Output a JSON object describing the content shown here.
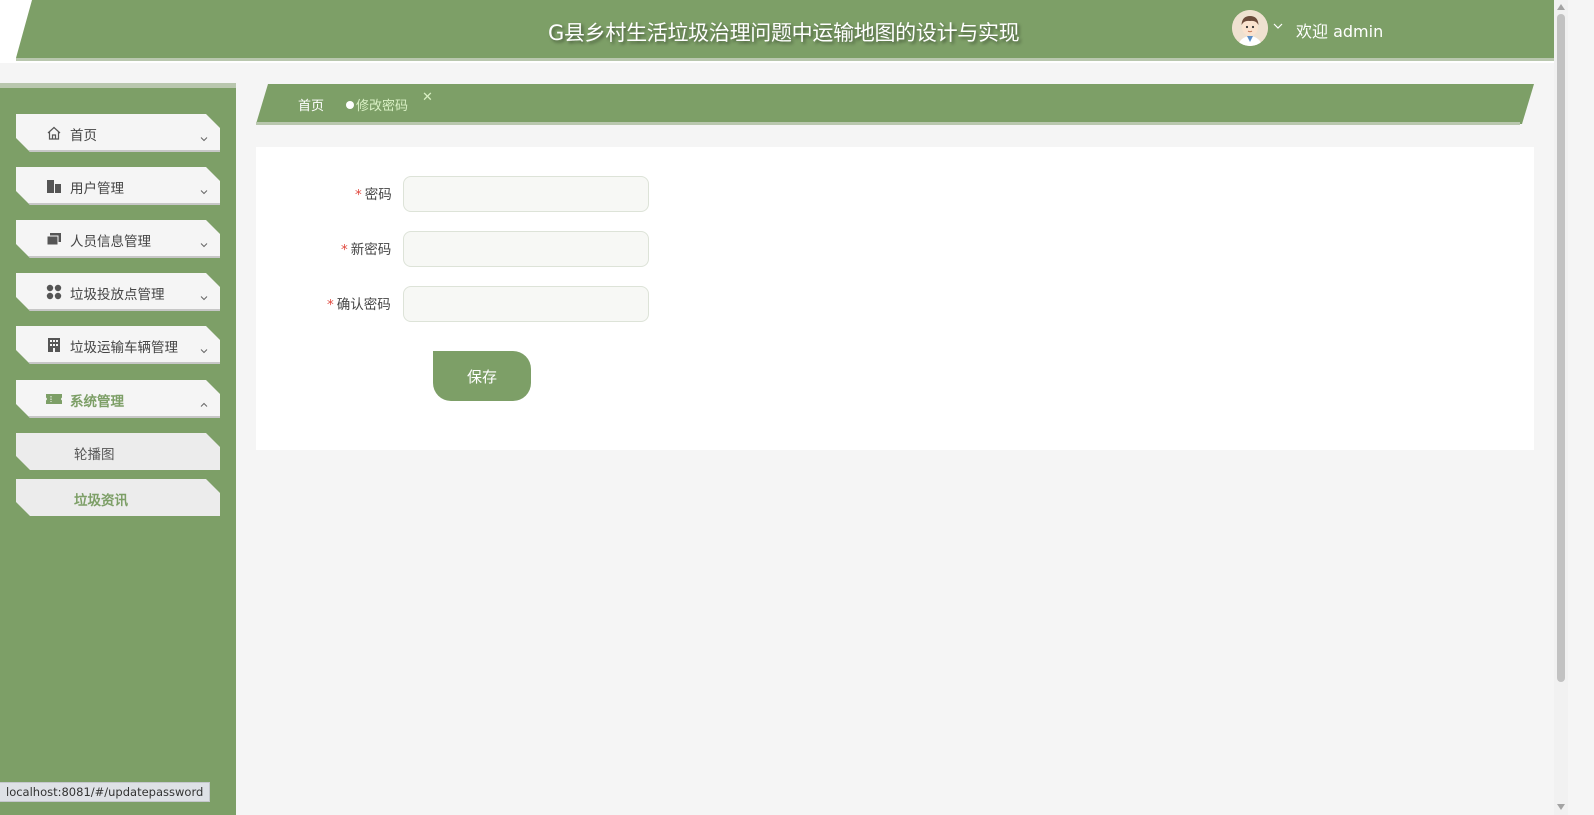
{
  "header": {
    "title": "G县乡村生活垃圾治理问题中运输地图的设计与实现",
    "welcome": "欢迎 admin",
    "avatar_icon": "user-avatar-icon"
  },
  "sidebar": {
    "items": [
      {
        "label": "首页",
        "icon": "home-icon",
        "expanded": false
      },
      {
        "label": "用户管理",
        "icon": "buildings-icon",
        "expanded": false
      },
      {
        "label": "人员信息管理",
        "icon": "folders-icon",
        "expanded": false
      },
      {
        "label": "垃圾投放点管理",
        "icon": "dots-grid-icon",
        "expanded": false
      },
      {
        "label": "垃圾运输车辆管理",
        "icon": "office-building-icon",
        "expanded": false
      },
      {
        "label": "系统管理",
        "icon": "ticket-icon",
        "expanded": true
      }
    ],
    "sub_items": [
      {
        "label": "轮播图"
      },
      {
        "label": "垃圾资讯"
      }
    ]
  },
  "tabs": {
    "home": "首页",
    "active": "修改密码",
    "close": "✕"
  },
  "form": {
    "password_label": "密码",
    "new_password_label": "新密码",
    "confirm_password_label": "确认密码",
    "required_mark": "*",
    "password_value": "",
    "new_password_value": "",
    "confirm_password_value": "",
    "save_label": "保存"
  },
  "status_bar": {
    "url": "localhost:8081/#/updatepassword"
  },
  "colors": {
    "primary": "#7d9f67",
    "accent_line": "#b9c7ae",
    "page_bg": "#f5f5f5",
    "required": "#e0473d"
  }
}
